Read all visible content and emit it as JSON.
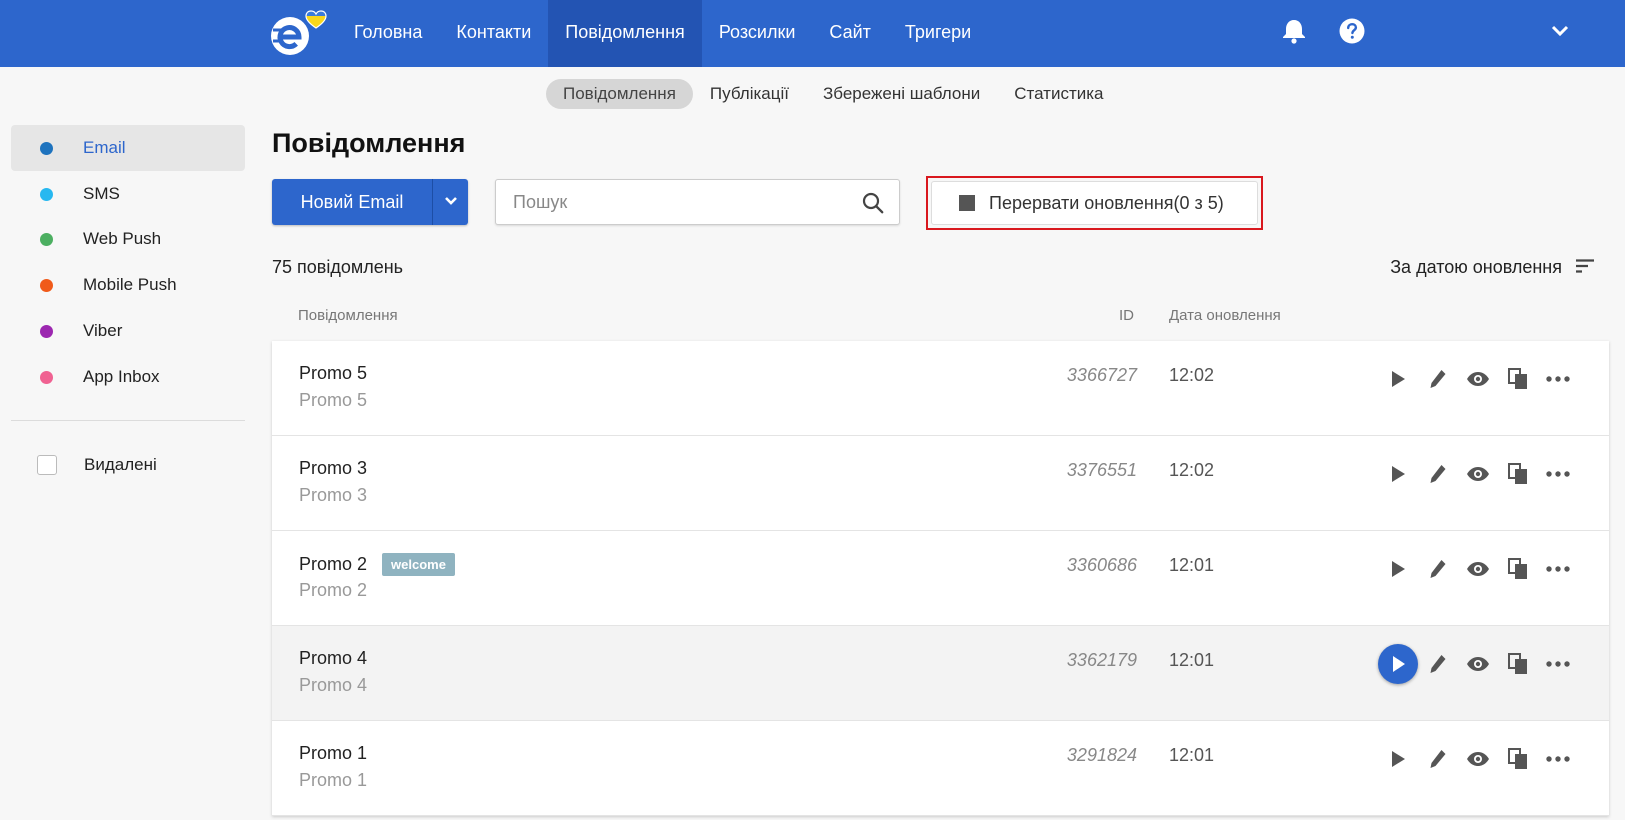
{
  "nav": {
    "items": [
      "Головна",
      "Контакти",
      "Повідомлення",
      "Розсилки",
      "Сайт",
      "Тригери"
    ],
    "active_index": 2
  },
  "subnav": {
    "items": [
      "Повідомлення",
      "Публікації",
      "Збережені шаблони",
      "Статистика"
    ],
    "active_index": 0
  },
  "sidebar": {
    "items": [
      {
        "label": "Email",
        "color": "#1e73be"
      },
      {
        "label": "SMS",
        "color": "#27b8f0"
      },
      {
        "label": "Web Push",
        "color": "#4caf61"
      },
      {
        "label": "Mobile Push",
        "color": "#f05a1a"
      },
      {
        "label": "Viber",
        "color": "#9c27b0"
      },
      {
        "label": "App Inbox",
        "color": "#f06292"
      }
    ],
    "deleted_label": "Видалені"
  },
  "main": {
    "title": "Повідомлення",
    "new_button": "Новий Email",
    "search_placeholder": "Пошук",
    "abort_label": "Перервати оновлення(0 з 5)",
    "count_label": "75 повідомлень",
    "sort_label": "За датою оновлення",
    "columns": {
      "message": "Повідомлення",
      "id": "ID",
      "date": "Дата оновлення"
    }
  },
  "rows": [
    {
      "name": "Promo 5",
      "subject": "Promo 5",
      "id": "3366727",
      "date": "12:02",
      "tag": ""
    },
    {
      "name": "Promo 3",
      "subject": "Promo 3",
      "id": "3376551",
      "date": "12:02",
      "tag": ""
    },
    {
      "name": "Promo 2",
      "subject": "Promo 2",
      "id": "3360686",
      "date": "12:01",
      "tag": "welcome"
    },
    {
      "name": "Promo 4",
      "subject": "Promo 4",
      "id": "3362179",
      "date": "12:01",
      "tag": ""
    },
    {
      "name": "Promo 1",
      "subject": "Promo 1",
      "id": "3291824",
      "date": "12:01",
      "tag": ""
    }
  ],
  "colors": {
    "brand": "#2d66cc",
    "highlight_border": "#d9181e",
    "tag": "#8fb3c0"
  }
}
